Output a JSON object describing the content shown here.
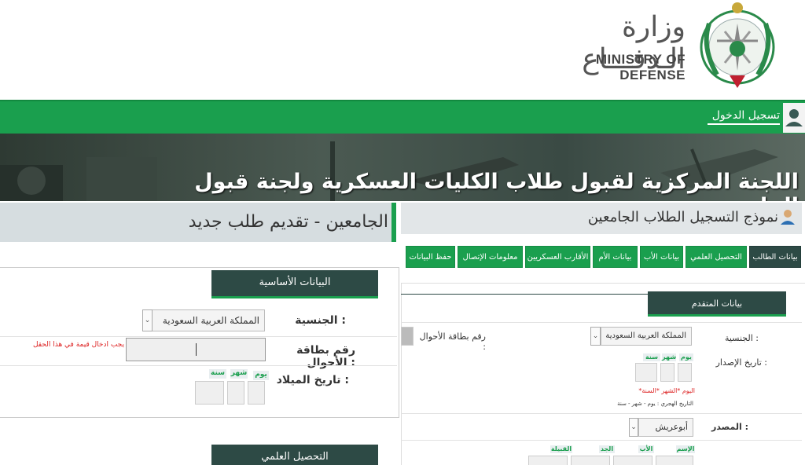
{
  "header": {
    "logo_ar": "وزارة الـدفـــاع",
    "logo_en": "MINISTRY OF DEFENSE",
    "login": "تسجيل الدخول"
  },
  "banner": {
    "title": "اللجنة المركزية لقبول طلاب الكليات العسكرية ولجنة قبول الجامعيين"
  },
  "left": {
    "title": "الجامعين - تقديم طلب جديد",
    "section_basic": "البيانات الأساسية",
    "nationality_label": "الجنسية :",
    "nationality_value": "المملكة العربية السعودية",
    "id_label": "رقم بطاقة الأحوال :",
    "id_error": "يجب ادخال قيمة في هذا الحقل",
    "dob_label": "تاريخ الميلاد :",
    "day": "يوم",
    "month": "شهر",
    "year": "سنة",
    "section_edu": "التحصيل العلمي"
  },
  "right": {
    "title": "نموذج التسجيل الطلاب الجامعين",
    "tabs": [
      "بيانات الطالب",
      "التحصيل العلمي",
      "بيانات الأب",
      "بيانات الأم",
      "الأقارب العسكريين",
      "معلومات الإتصال",
      "حفظ البيانات"
    ],
    "section_applicant": "بيانات المتقدم",
    "nationality_label": "الجنسية :",
    "nationality_value": "المملكة العربية السعودية",
    "id_label": "رقم بطاقة الأحوال :",
    "issue_date_label": "تاريخ الإصدار :",
    "day": "يوم",
    "month": "شهر",
    "year": "سنة",
    "date_hint_red": "*اليوم *الشهر *السنة",
    "date_hint": "التاريخ الهجري : يوم - شهر - سنة",
    "source_label": "المصدر :",
    "source_value": "أبوعريش",
    "name_labels": [
      "الإسم",
      "الأب",
      "الجد",
      "القبيلة"
    ]
  },
  "colors": {
    "green": "#1a9f4e",
    "dark_teal": "#2d4a45",
    "error_red": "#dd2222"
  }
}
